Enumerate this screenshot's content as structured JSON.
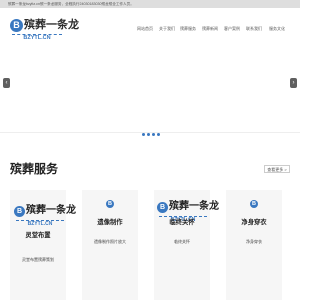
{
  "topbar": {
    "text": "殡葬一条龙bzyltz.cn殡一条龙服务，全程执行24030183030殡龙殡全工作人员。"
  },
  "brand": {
    "glyph": "B",
    "title": "殡葬一条龙",
    "subtitle": "BZYTL.CN"
  },
  "nav": {
    "items": [
      {
        "label": "网站首页"
      },
      {
        "label": "关于我们"
      },
      {
        "label": "殡葬服务"
      },
      {
        "label": "殡葬新闻"
      },
      {
        "label": "客户案例"
      },
      {
        "label": "联系我们"
      },
      {
        "label": "服务文化"
      }
    ]
  },
  "carousel": {
    "prev": "‹",
    "next": "›"
  },
  "services": {
    "title": "殡葬服务",
    "more_label": "查看更多 >",
    "cards": [
      {
        "title": "灵堂布置",
        "desc": "灵堂布置殡葬策划"
      },
      {
        "title": "遗像制作",
        "desc": "遗像制作照片放大"
      },
      {
        "title": "临终关怀",
        "desc": "临终关怀"
      },
      {
        "title": "净身穿衣",
        "desc": "净身穿衣"
      }
    ]
  }
}
